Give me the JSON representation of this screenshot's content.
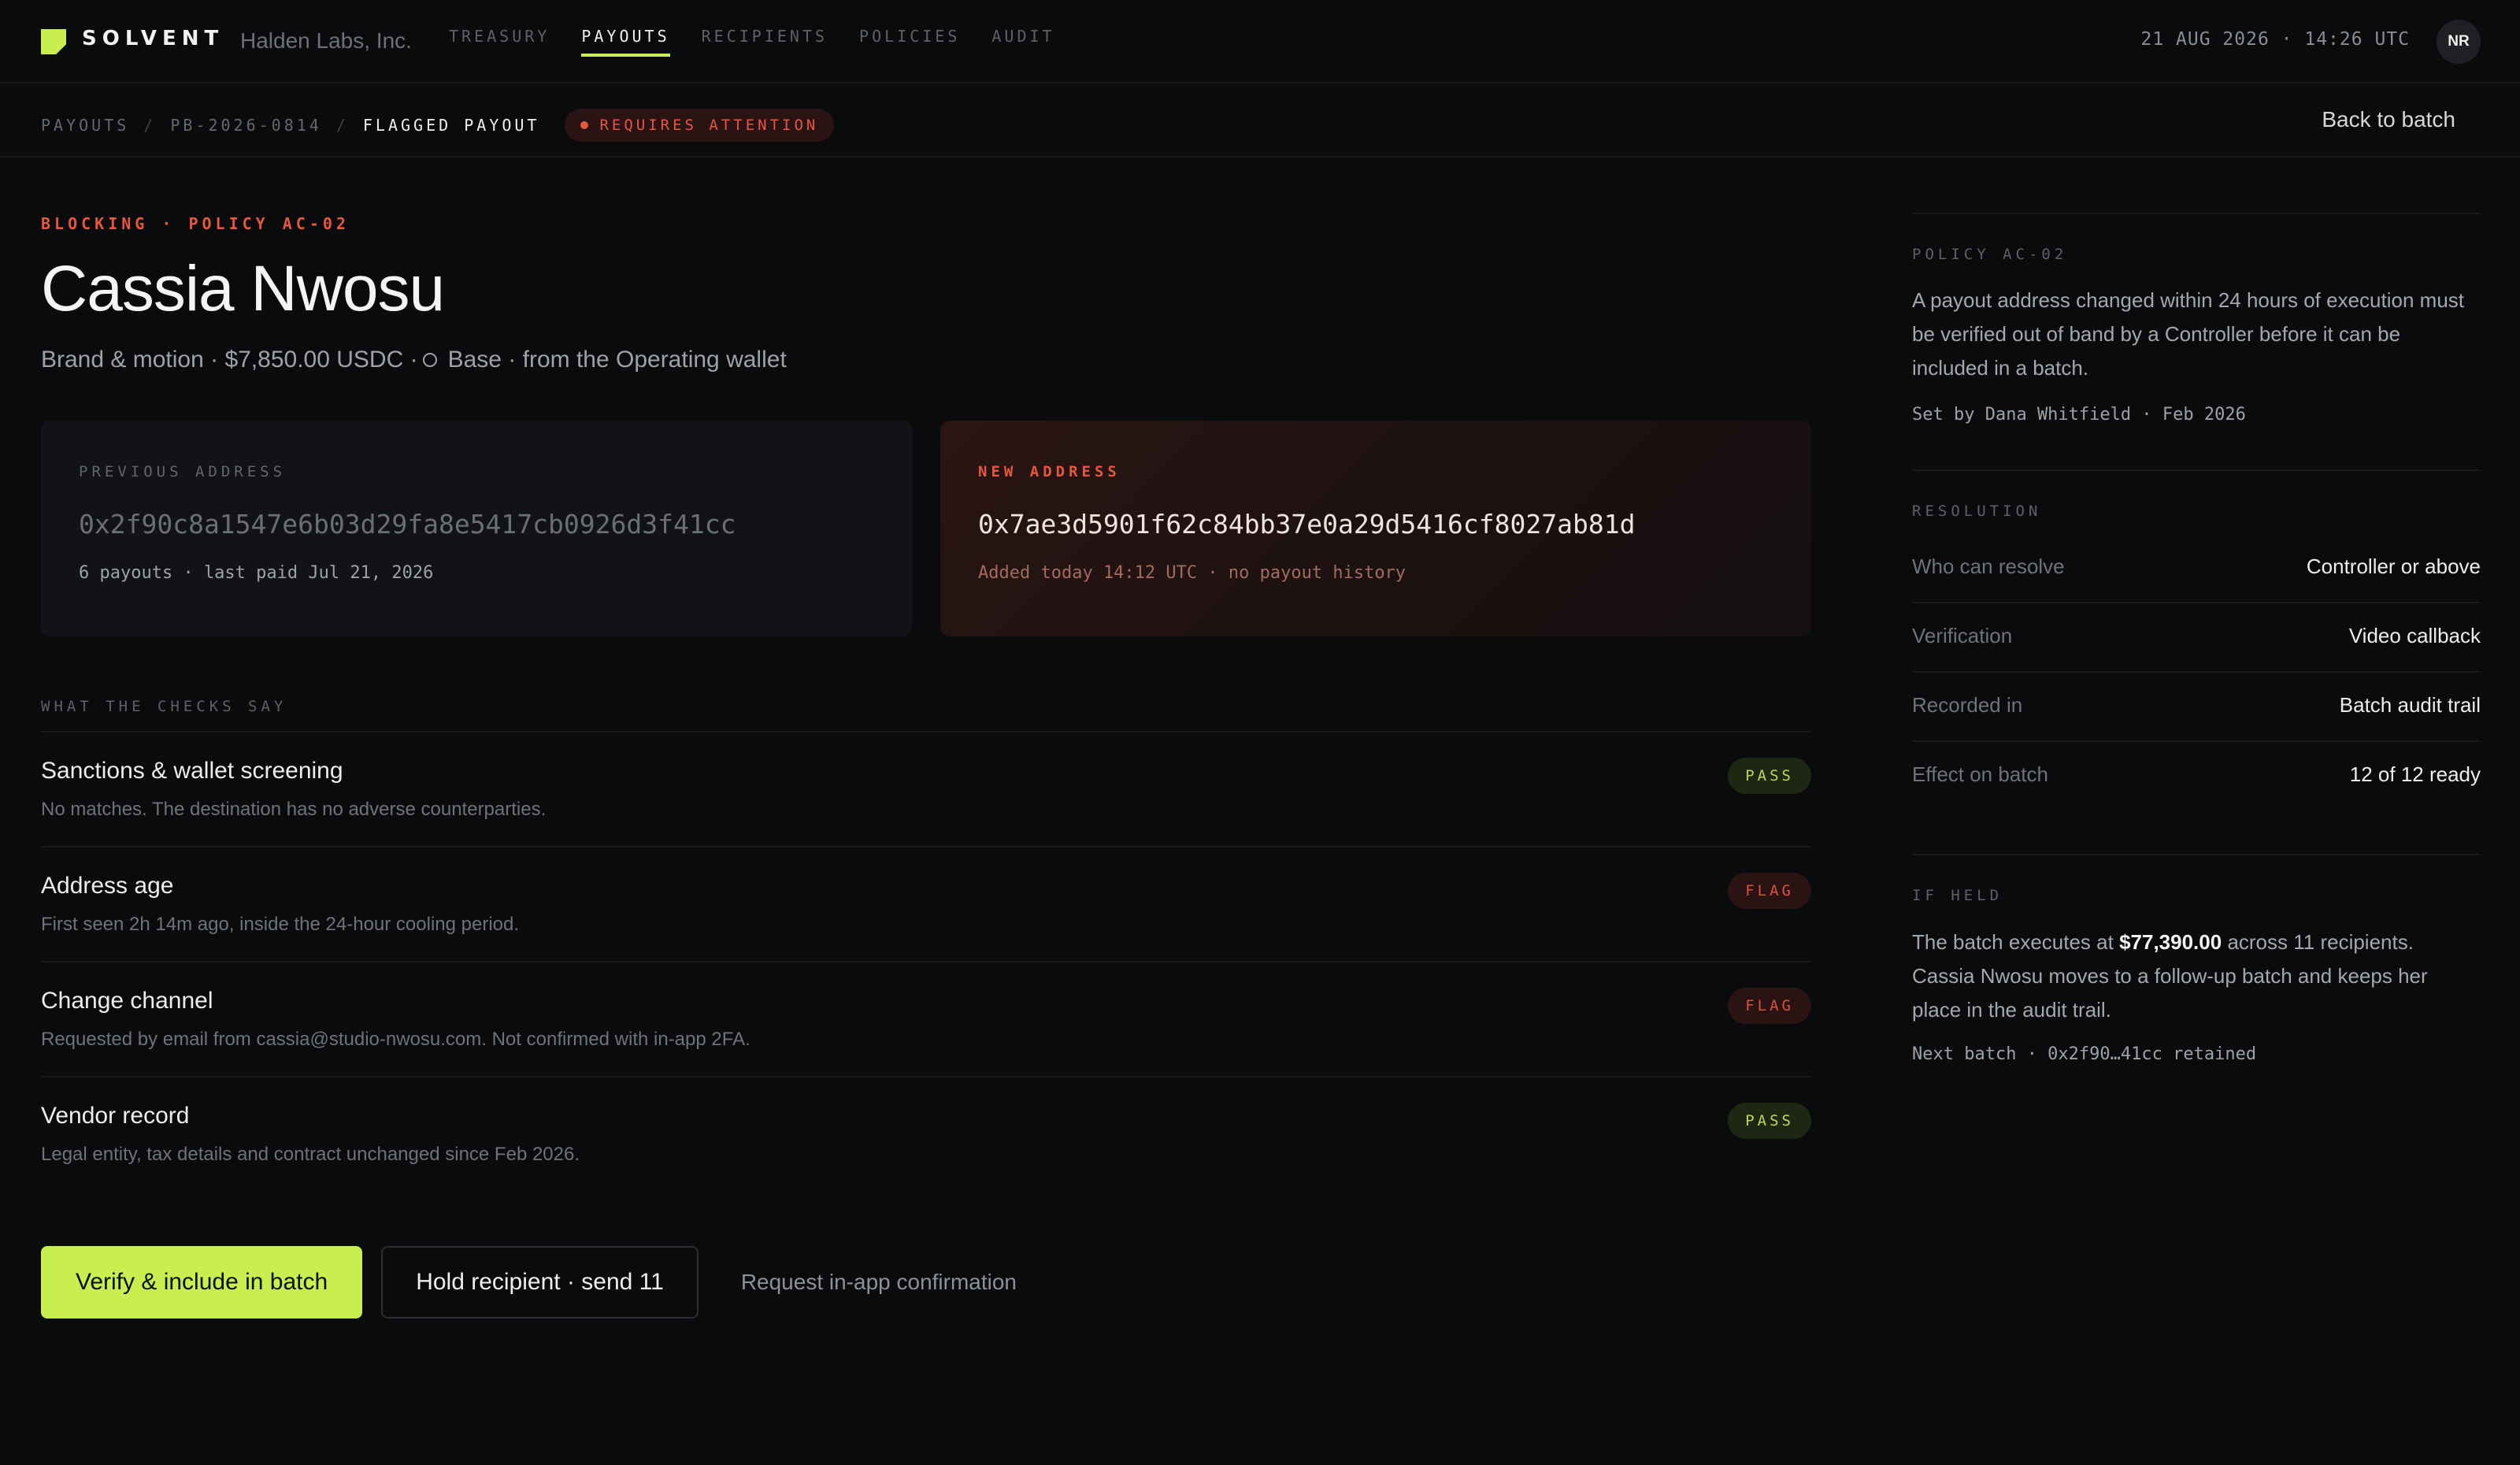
{
  "app": {
    "brand": "SOLVENT",
    "org": "Halden Labs, Inc.",
    "nav": [
      "TREASURY",
      "PAYOUTS",
      "RECIPIENTS",
      "POLICIES",
      "AUDIT"
    ],
    "active_nav": "PAYOUTS",
    "clock": "21 AUG 2026 · 14:26 UTC",
    "avatar_initials": "NR",
    "accent_color": "#c8ee4f",
    "alert_color": "#e5573f"
  },
  "breadcrumb": {
    "items": [
      "PAYOUTS",
      "PB-2026-0814",
      "FLAGGED PAYOUT"
    ],
    "status_badge": "REQUIRES ATTENTION",
    "back_link": "Back to batch"
  },
  "header": {
    "eyebrow": "BLOCKING · POLICY AC-02",
    "title": "Cassia Nwosu",
    "subtitle_pre": "Brand & motion · $7,850.00 USDC ·",
    "subtitle_post": "Base · from the Operating wallet"
  },
  "addresses": {
    "previous": {
      "label": "PREVIOUS ADDRESS",
      "value": "0x2f90c8a1547e6b03d29fa8e5417cb0926d3f41cc",
      "meta": "6 payouts · last paid Jul 21, 2026"
    },
    "new": {
      "label": "NEW ADDRESS",
      "value": "0x7ae3d5901f62c84bb37e0a29d5416cf8027ab81d",
      "meta": "Added today 14:12 UTC · no payout history"
    }
  },
  "checks": {
    "label": "WHAT THE CHECKS SAY",
    "items": [
      {
        "title": "Sanctions & wallet screening",
        "desc": "No matches. The destination has no adverse counterparties.",
        "status": "PASS"
      },
      {
        "title": "Address age",
        "desc": "First seen 2h 14m ago, inside the 24-hour cooling period.",
        "status": "FLAG"
      },
      {
        "title": "Change channel",
        "desc": "Requested by email from cassia@studio-nwosu.com. Not confirmed with in-app 2FA.",
        "status": "FLAG"
      },
      {
        "title": "Vendor record",
        "desc": "Legal entity, tax details and contract unchanged since Feb 2026.",
        "status": "PASS"
      }
    ]
  },
  "actions": {
    "primary": "Verify & include in batch",
    "secondary": "Hold recipient · send 11",
    "tertiary": "Request in-app confirmation"
  },
  "side": {
    "policy": {
      "label": "POLICY AC-02",
      "text": "A payout address changed within 24 hours of execution must be verified out of band by a Controller before it can be included in a batch.",
      "meta": "Set by Dana Whitfield · Feb 2026"
    },
    "resolution": {
      "label": "RESOLUTION",
      "rows": [
        {
          "key": "Who can resolve",
          "value": "Controller or above"
        },
        {
          "key": "Verification",
          "value": "Video callback"
        },
        {
          "key": "Recorded in",
          "value": "Batch audit trail"
        },
        {
          "key": "Effect on batch",
          "value": "12 of 12 ready"
        }
      ]
    },
    "if_held": {
      "label": "IF HELD",
      "text_pre": "The batch executes at",
      "amount": "$77,390.00",
      "text_post": "across 11 recipients. Cassia Nwosu moves to a follow-up batch and keeps her place in the audit trail.",
      "meta": "Next batch · 0x2f90…41cc retained"
    }
  }
}
